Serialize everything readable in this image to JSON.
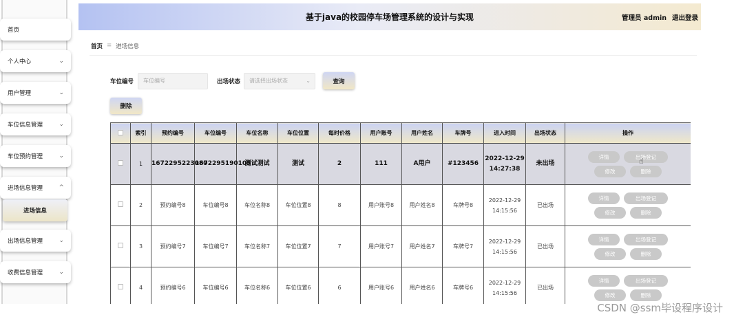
{
  "header": {
    "title": "基于java的校园停车场管理系统的设计与实现",
    "user_label": "管理员 admin",
    "logout_label": "退出登录"
  },
  "sidebar": {
    "items": [
      {
        "label": "首页",
        "chevron": ""
      },
      {
        "label": "个人中心",
        "chevron": "⌄"
      },
      {
        "label": "用户管理",
        "chevron": "⌄"
      },
      {
        "label": "车位信息管理",
        "chevron": "⌄"
      },
      {
        "label": "车位预约管理",
        "chevron": "⌄"
      },
      {
        "label": "进场信息管理",
        "chevron": "^"
      },
      {
        "label": "出场信息管理",
        "chevron": "⌄"
      },
      {
        "label": "收费信息管理",
        "chevron": "⌄"
      }
    ],
    "sub_item": "进场信息"
  },
  "breadcrumb": {
    "home": "首页",
    "separator": "≡",
    "current": "进场信息"
  },
  "search": {
    "spot_label": "车位编号",
    "spot_placeholder": "车位编号",
    "status_label": "出场状态",
    "status_placeholder": "请选择出场状态",
    "query_button": "查询",
    "delete_button": "删除"
  },
  "table": {
    "headers": [
      "",
      "索引",
      "预约编号",
      "车位编号",
      "车位名称",
      "车位位置",
      "每时价格",
      "用户账号",
      "用户姓名",
      "车牌号",
      "进入时间",
      "出场状态",
      "操作"
    ],
    "actions": {
      "detail": "详情",
      "exit_register": "出场登记",
      "edit": "修改",
      "delete": "删除"
    },
    "rows": [
      {
        "index": "1",
        "reservation_no": "1672295223080",
        "spot_no": "1672295190105",
        "spot_name": "测试测试",
        "spot_location": "测试",
        "price": "2",
        "account": "111",
        "user_name": "A用户",
        "plate": "#123456",
        "entry_time": "2022-12-29 14:27:38",
        "status": "未出场"
      },
      {
        "index": "2",
        "reservation_no": "预约编号8",
        "spot_no": "车位编号8",
        "spot_name": "车位名称8",
        "spot_location": "车位位置8",
        "price": "8",
        "account": "用户账号8",
        "user_name": "用户姓名8",
        "plate": "车牌号8",
        "entry_time": "2022-12-29 14:15:56",
        "status": "已出场"
      },
      {
        "index": "3",
        "reservation_no": "预约编号7",
        "spot_no": "车位编号7",
        "spot_name": "车位名称7",
        "spot_location": "车位位置7",
        "price": "7",
        "account": "用户账号7",
        "user_name": "用户姓名7",
        "plate": "车牌号7",
        "entry_time": "2022-12-29 14:15:56",
        "status": "已出场"
      },
      {
        "index": "4",
        "reservation_no": "预约编号6",
        "spot_no": "车位编号6",
        "spot_name": "车位名称6",
        "spot_location": "车位位置6",
        "price": "6",
        "account": "用户账号6",
        "user_name": "用户姓名6",
        "plate": "车牌号6",
        "entry_time": "2022-12-29 14:15:56",
        "status": "已出场"
      }
    ]
  },
  "watermark": "CSDN @ssm毕设程序设计"
}
